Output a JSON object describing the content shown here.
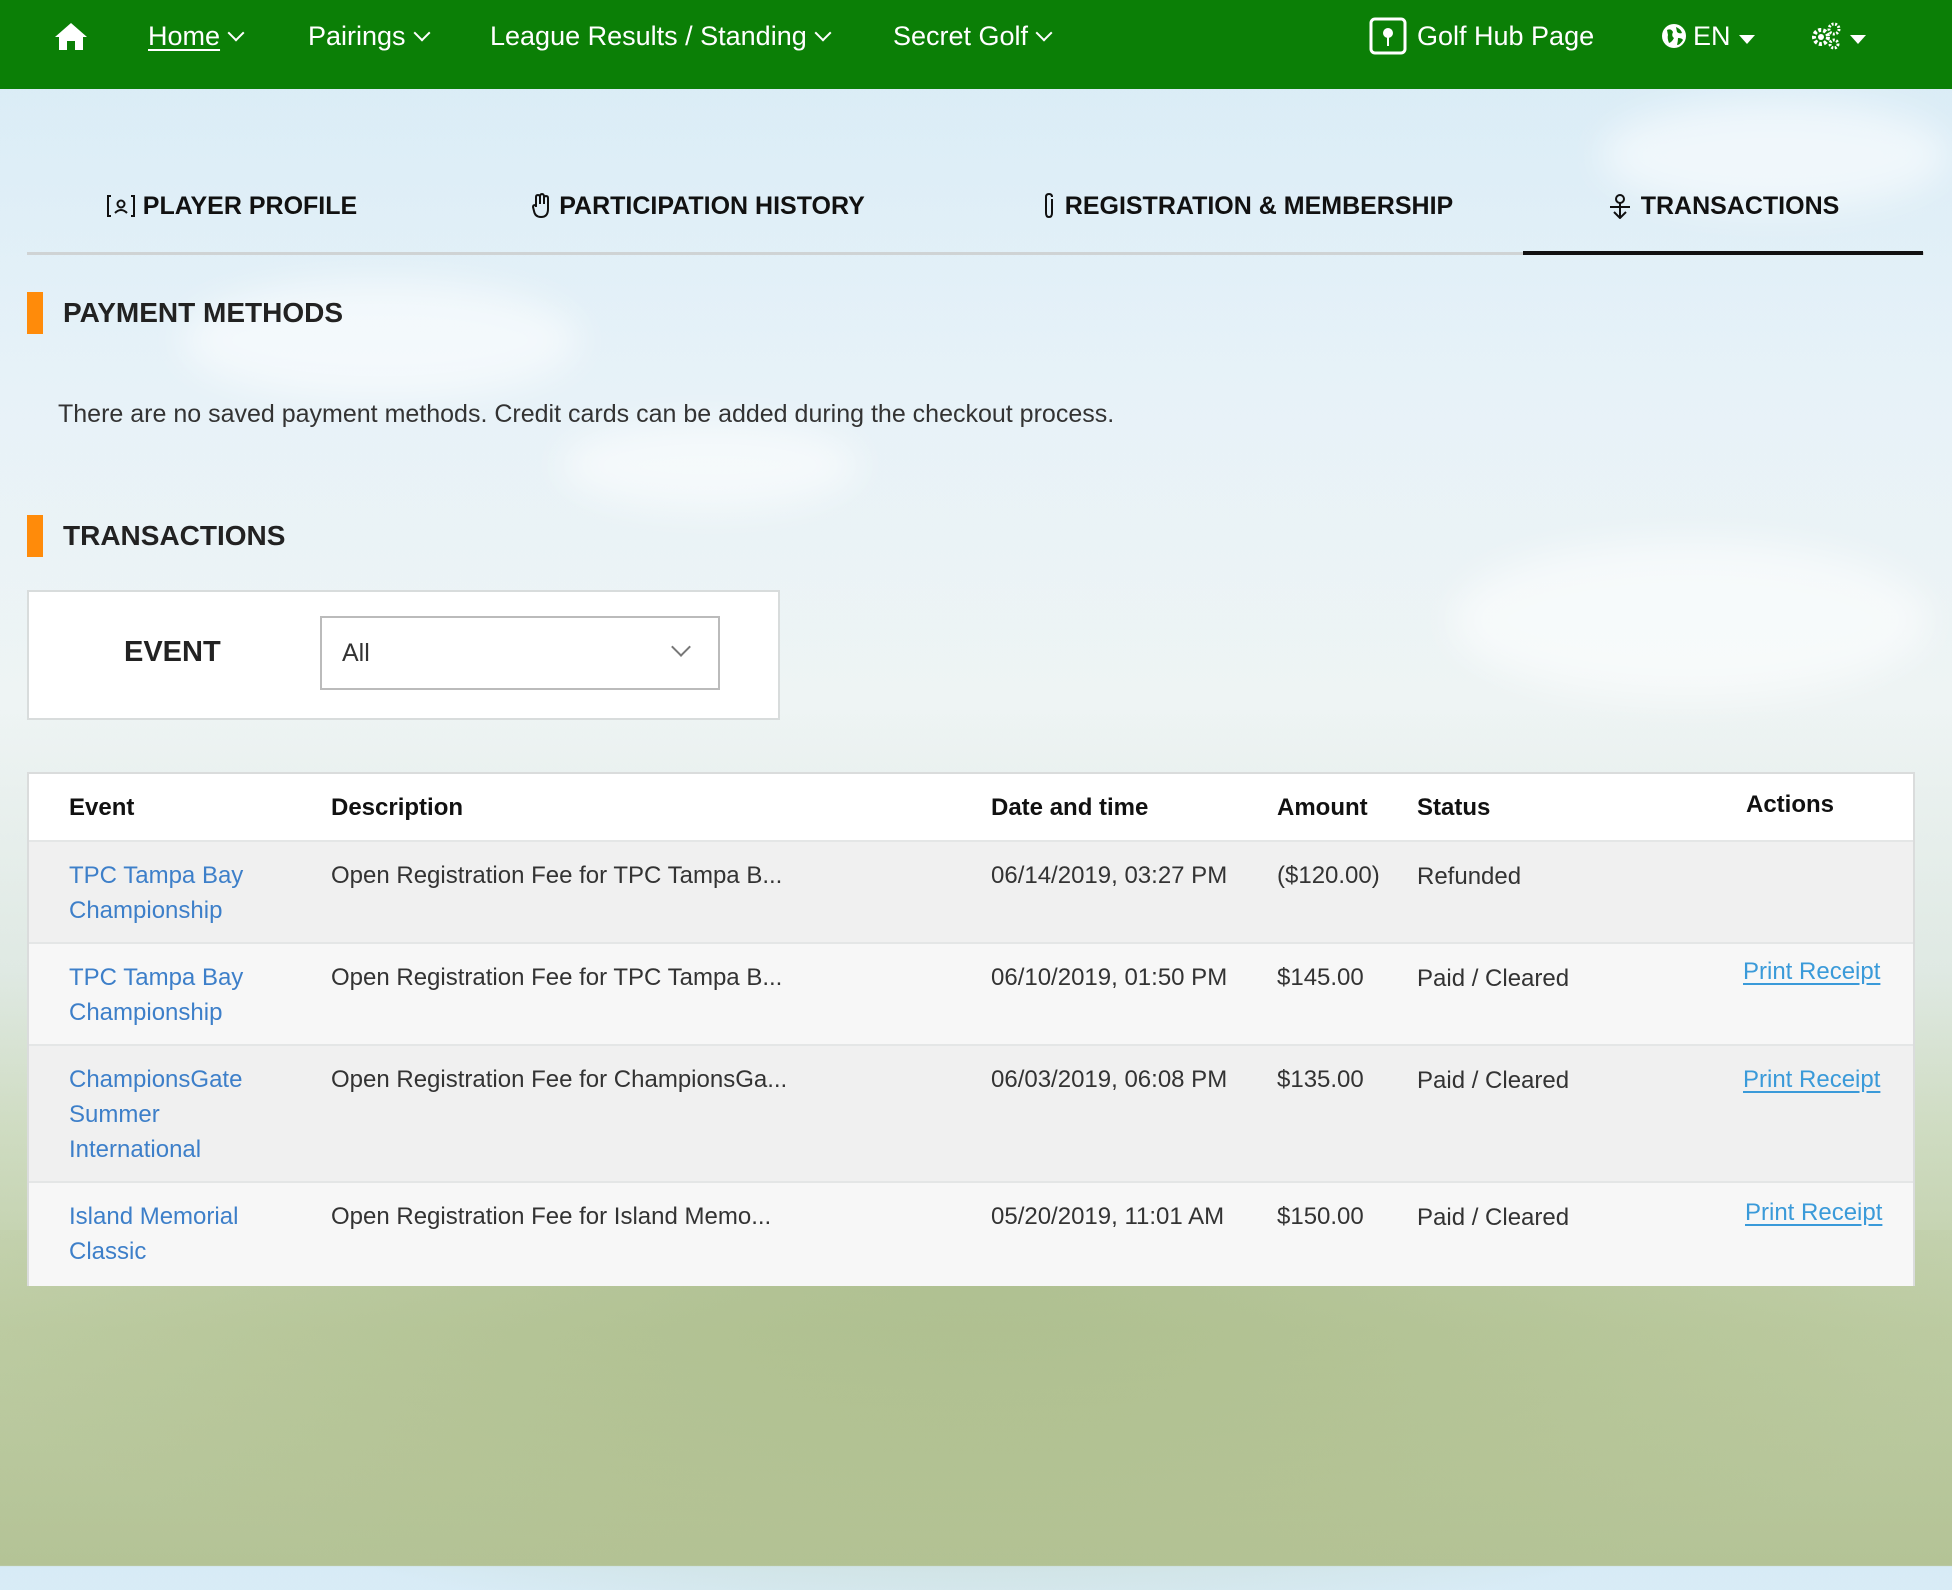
{
  "nav": {
    "home": "Home",
    "pairings": "Pairings",
    "league": "League Results / Standing",
    "secret": "Secret Golf",
    "hub": "Golf Hub Page",
    "lang": "EN"
  },
  "tabs": [
    {
      "label": "PLAYER PROFILE"
    },
    {
      "label": "PARTICIPATION HISTORY"
    },
    {
      "label": "REGISTRATION & MEMBERSHIP"
    },
    {
      "label": "TRANSACTIONS"
    }
  ],
  "payment": {
    "title": "PAYMENT METHODS",
    "note": "There are no saved payment methods. Credit cards can be added during the checkout process."
  },
  "transactions": {
    "title": "TRANSACTIONS",
    "filter_label": "EVENT",
    "filter_value": "All",
    "headers": {
      "event": "Event",
      "description": "Description",
      "date": "Date and time",
      "amount": "Amount",
      "status": "Status",
      "actions": "Actions"
    },
    "rows": [
      {
        "event": [
          "TPC Tampa Bay",
          "Championship"
        ],
        "description": "Open Registration Fee for TPC Tampa B...",
        "date": "06/14/2019, 03:27 PM",
        "amount": "($120.00)",
        "status": "Refunded",
        "action": ""
      },
      {
        "event": [
          "TPC Tampa Bay",
          "Championship"
        ],
        "description": "Open Registration Fee for TPC Tampa B...",
        "date": "06/10/2019, 01:50 PM",
        "amount": "$145.00",
        "status": "Paid / Cleared",
        "action": "Print Receipt"
      },
      {
        "event": [
          "ChampionsGate",
          "Summer",
          "International"
        ],
        "description": "Open Registration Fee for ChampionsGa...",
        "date": "06/03/2019, 06:08 PM",
        "amount": "$135.00",
        "status": "Paid / Cleared",
        "action": "Print Receipt"
      },
      {
        "event": [
          "Island Memorial",
          "Classic"
        ],
        "description": "Open Registration Fee for Island Memo...",
        "date": "05/20/2019, 11:01 AM",
        "amount": "$150.00",
        "status": "Paid / Cleared",
        "action": "Print Receipt"
      }
    ]
  }
}
